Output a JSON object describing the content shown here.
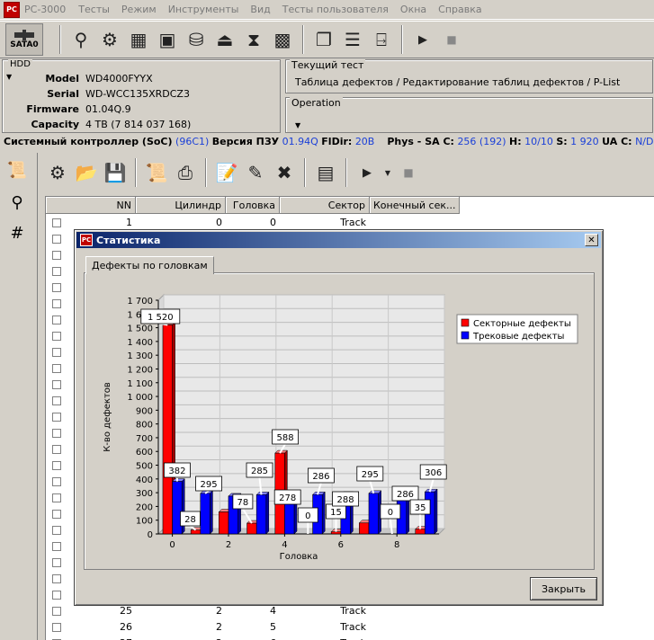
{
  "app": {
    "title": "PC-3000"
  },
  "menu": [
    "Тесты",
    "Режим",
    "Инструменты",
    "Вид",
    "Тесты пользователя",
    "Окна",
    "Справка"
  ],
  "toolbar": {
    "sata_label": "SATA0"
  },
  "hdd": {
    "group_title": "HDD",
    "fields": [
      {
        "label": "Model",
        "value": "WD4000FYYX"
      },
      {
        "label": "Serial",
        "value": "WD-WCC135XRDCZ3"
      },
      {
        "label": "Firmware",
        "value": "01.04Q.9"
      },
      {
        "label": "Capacity",
        "value": "4 TB (7 814 037 168)"
      }
    ]
  },
  "current_test": {
    "title": "Текущий тест",
    "value": "Таблица дефектов / Редактирование таблиц дефектов / P-List"
  },
  "operation": {
    "title": "Operation"
  },
  "status": {
    "soc_label": "Системный контроллер (SoC)",
    "soc_value": "(96C1)",
    "rom_label": "Версия ПЗУ",
    "rom_value": "01.94Q",
    "fldir_label": "FlDir:",
    "fldir_value": "20B",
    "phys_label": "Phys - SA C:",
    "phys_value": "256 (192)",
    "h_label": "H:",
    "h_value": "10/10",
    "s_label": "S:",
    "s_value": "1 920",
    "uac_label": "UA C:",
    "uac_value": "N/D"
  },
  "table": {
    "columns": [
      "NN",
      "Цилиндр",
      "Головка",
      "Сектор",
      "Конечный сек..."
    ],
    "rows": [
      {
        "nn": "1",
        "cyl": "0",
        "head": "0",
        "sector": "Track"
      },
      {
        "nn": "25",
        "cyl": "2",
        "head": "4",
        "sector": "Track"
      },
      {
        "nn": "26",
        "cyl": "2",
        "head": "5",
        "sector": "Track"
      },
      {
        "nn": "27",
        "cyl": "2",
        "head": "6",
        "sector": "Track"
      }
    ]
  },
  "dialog": {
    "title": "Статистика",
    "tab": "Дефекты по головкам",
    "close_button": "Закрыть"
  },
  "chart_data": {
    "type": "bar",
    "x": [
      0,
      1,
      2,
      3,
      4,
      5,
      6,
      7,
      8,
      9
    ],
    "xticks": [
      "0",
      "2",
      "4",
      "6",
      "8"
    ],
    "xlabel": "Головка",
    "ylabel": "К-во дефектов",
    "ylim": [
      0,
      1700
    ],
    "yticks": [
      "0",
      "100",
      "200",
      "300",
      "400",
      "500",
      "600",
      "700",
      "800",
      "900",
      "1 000",
      "1 100",
      "1 200",
      "1 300",
      "1 400",
      "1 500",
      "1 600",
      "1 700"
    ],
    "grid": true,
    "legend": "top-right",
    "series": [
      {
        "name": "Секторные дефекты",
        "color": "#ff0000",
        "values": [
          1520,
          28,
          160,
          78,
          588,
          0,
          15,
          80,
          0,
          35
        ],
        "labels": [
          "1 520",
          "28",
          "",
          "78",
          "588",
          "0",
          "15",
          "",
          "0",
          "35"
        ]
      },
      {
        "name": "Трековые дефекты",
        "color": "#0000ff",
        "values": [
          382,
          295,
          275,
          285,
          278,
          286,
          288,
          295,
          286,
          306
        ],
        "labels": [
          "382",
          "295",
          "",
          "285",
          "278",
          "286",
          "288",
          "295",
          "286",
          "306"
        ]
      }
    ]
  }
}
